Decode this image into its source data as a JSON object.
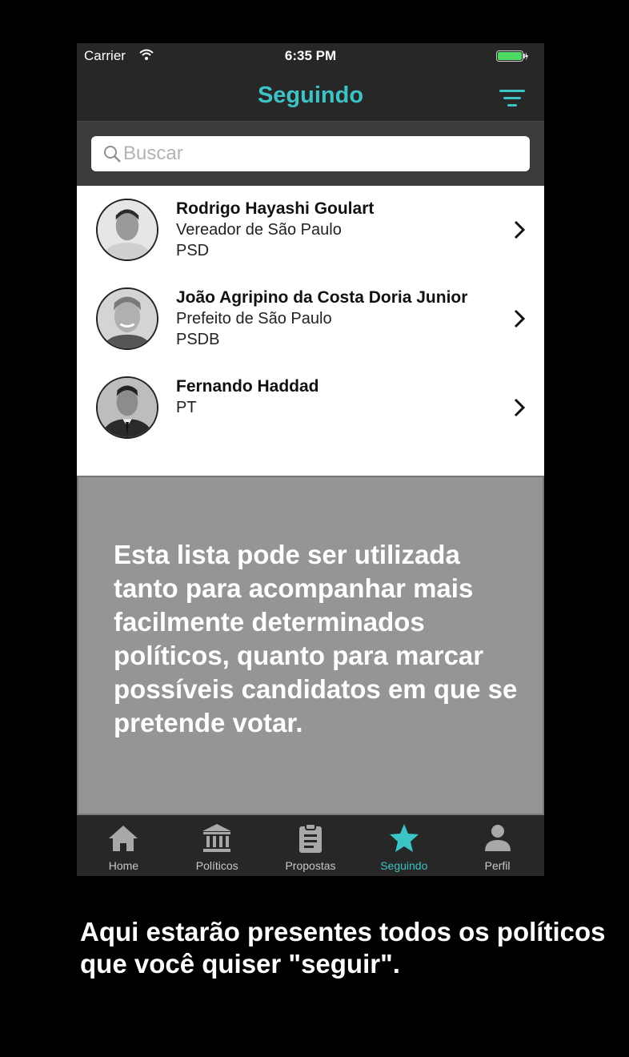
{
  "status_bar": {
    "carrier": "Carrier",
    "time": "6:35 PM",
    "battery_color": "#4cd964"
  },
  "nav": {
    "title": "Seguindo",
    "accent_color": "#3cc3c6",
    "filter_icon": "filter-icon"
  },
  "search": {
    "placeholder": "Buscar",
    "value": ""
  },
  "politicians": [
    {
      "name": "Rodrigo Hayashi Goulart",
      "lines": [
        "Vereador de São Paulo",
        "PSD"
      ]
    },
    {
      "name": "João Agripino da Costa Doria Junior",
      "lines": [
        "Prefeito de São Paulo",
        "PSDB"
      ]
    },
    {
      "name": "Fernando Haddad",
      "lines": [
        "PT",
        ""
      ]
    }
  ],
  "overlay": {
    "text": "Esta lista pode ser utilizada tanto para acompanhar mais facilmente determinados políticos, quanto para marcar possíveis candidatos em que se pretende votar."
  },
  "tabs": [
    {
      "label": "Home",
      "icon": "home-icon"
    },
    {
      "label": "Políticos",
      "icon": "building-icon"
    },
    {
      "label": "Propostas",
      "icon": "clipboard-icon"
    },
    {
      "label": "Seguindo",
      "icon": "star-icon",
      "active": true
    },
    {
      "label": "Perfil",
      "icon": "person-icon"
    }
  ],
  "caption": "Aqui estarão presentes todos os políticos que você quiser \"seguir\"."
}
